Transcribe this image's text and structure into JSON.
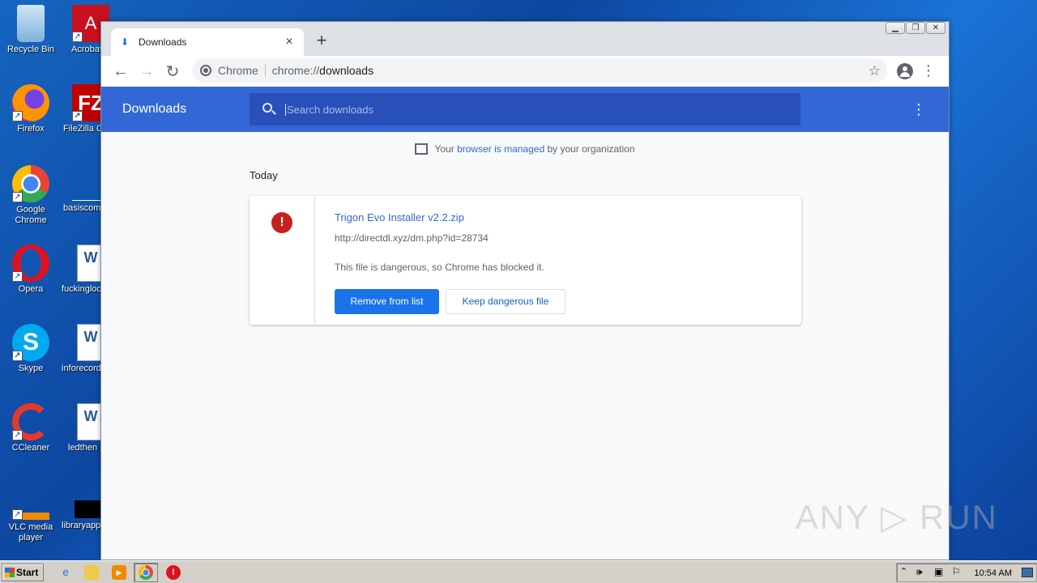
{
  "desktop": {
    "icons_col1": [
      {
        "label": "Recycle Bin",
        "icon": "recycle-bin-icon"
      },
      {
        "label": "Firefox",
        "icon": "firefox-icon"
      },
      {
        "label": "Google Chrome",
        "icon": "chrome-icon"
      },
      {
        "label": "Opera",
        "icon": "opera-icon"
      },
      {
        "label": "Skype",
        "icon": "skype-icon"
      },
      {
        "label": "CCleaner",
        "icon": "ccleaner-icon"
      },
      {
        "label": "VLC media player",
        "icon": "vlc-icon"
      }
    ],
    "icons_col2": [
      {
        "label": "Acrobat Reader",
        "icon": "acrobat-icon"
      },
      {
        "label": "FileZilla C",
        "icon": "filezilla-icon"
      },
      {
        "label": "basiscomm",
        "icon": "document-icon"
      },
      {
        "label": "fuckingloc",
        "icon": "word-doc-icon"
      },
      {
        "label": "inforecord",
        "icon": "word-doc-icon"
      },
      {
        "label": "ledthen",
        "icon": "word-doc-icon"
      },
      {
        "label": "libraryapp",
        "icon": "terminal-icon"
      }
    ]
  },
  "browser": {
    "tab": {
      "title": "Downloads",
      "close": "×"
    },
    "new_tab": "+",
    "omnibox": {
      "host": "Chrome",
      "url_prefix": "chrome://",
      "url_path": "downloads"
    }
  },
  "downloads": {
    "header_title": "Downloads",
    "search_placeholder": "Search downloads",
    "managed": {
      "pre": "Your ",
      "link": "browser is managed",
      "post": " by your organization"
    },
    "section_date": "Today",
    "item": {
      "filename": "Trigon Evo Installer v2.2.zip",
      "url": "http://directdl.xyz/dm.php?id=28734",
      "message": "This file is dangerous, so Chrome has blocked it.",
      "remove_label": "Remove from list",
      "keep_label": "Keep dangerous file"
    }
  },
  "watermark": "ANY ▷ RUN",
  "taskbar": {
    "start_label": "Start",
    "clock": "10:54 AM"
  },
  "colors": {
    "header": "#3367d6",
    "primary_button": "#1a73e8",
    "danger": "#c5221f"
  }
}
